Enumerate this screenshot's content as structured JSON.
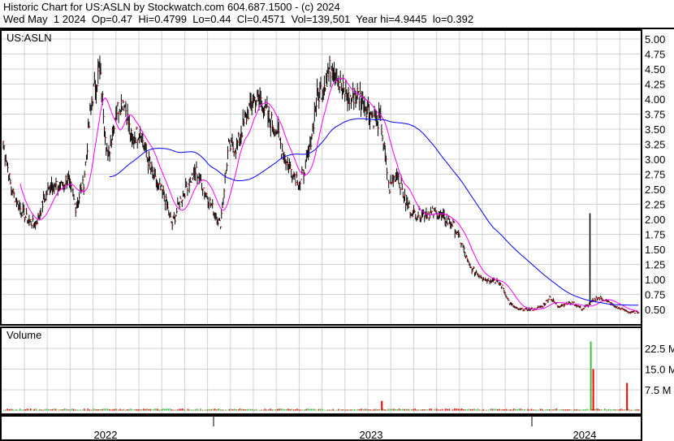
{
  "header": {
    "title": "Historic Chart for US:ASLN by Stockwatch.com 604.687.1500 - (c) 2024",
    "stats": "Wed May  1 2024  Op=0.47  Hi=0.4799  Lo=0.44  Cl=0.4571  Vol=139,501  Year hi=4.9445  lo=0.392"
  },
  "chart_data": {
    "type": "line",
    "title": "US:ASLN",
    "volume_label": "Volume",
    "price_ticks": [
      "0.50",
      "0.75",
      "1.00",
      "1.25",
      "1.50",
      "1.75",
      "2.00",
      "2.25",
      "2.50",
      "2.75",
      "3.00",
      "3.25",
      "3.50",
      "3.75",
      "4.00",
      "4.25",
      "4.50",
      "4.75",
      "5.00"
    ],
    "price_ylim": [
      0.5,
      5.0
    ],
    "volume_ticks": [
      "7.5 M",
      "15.0 M",
      "22.5 M"
    ],
    "volume_ylim_millions": [
      0,
      22.5
    ],
    "x_labels": [
      "2022",
      "2023",
      "2024"
    ],
    "closes_weekly": [
      3.3,
      2.5,
      2.2,
      2.0,
      1.9,
      2.3,
      2.6,
      2.5,
      2.7,
      2.2,
      2.6,
      4.0,
      4.5,
      3.0,
      3.8,
      4.0,
      3.3,
      3.5,
      3.0,
      2.6,
      2.4,
      1.9,
      2.3,
      2.6,
      2.8,
      2.5,
      2.2,
      1.9,
      3.2,
      3.2,
      3.6,
      4.0,
      4.0,
      3.7,
      3.5,
      3.0,
      2.8,
      2.6,
      3.1,
      4.0,
      4.3,
      4.6,
      4.2,
      4.0,
      4.1,
      3.9,
      3.7,
      3.6,
      2.5,
      2.8,
      2.3,
      2.1,
      2.1,
      2.1,
      2.1,
      2.0,
      1.9,
      1.6,
      1.2,
      1.1,
      1.0,
      1.0,
      0.9,
      0.6,
      0.5,
      0.5,
      0.5,
      0.55,
      0.7,
      0.55,
      0.6,
      0.6,
      0.5,
      0.6,
      0.7,
      0.65,
      0.55,
      0.5,
      0.45,
      0.46
    ],
    "spikes": [
      {
        "week": 73,
        "high": 2.1
      }
    ],
    "volume_spikes_millions": [
      {
        "week": 47,
        "value": 3.5,
        "dir": "down"
      },
      {
        "week": 73,
        "value": 25,
        "dir": "up"
      },
      {
        "week": 73.3,
        "value": 15,
        "dir": "down"
      },
      {
        "week": 77.5,
        "value": 10,
        "dir": "down"
      }
    ],
    "ma_series": [
      "pink short MA",
      "blue long MA"
    ]
  }
}
